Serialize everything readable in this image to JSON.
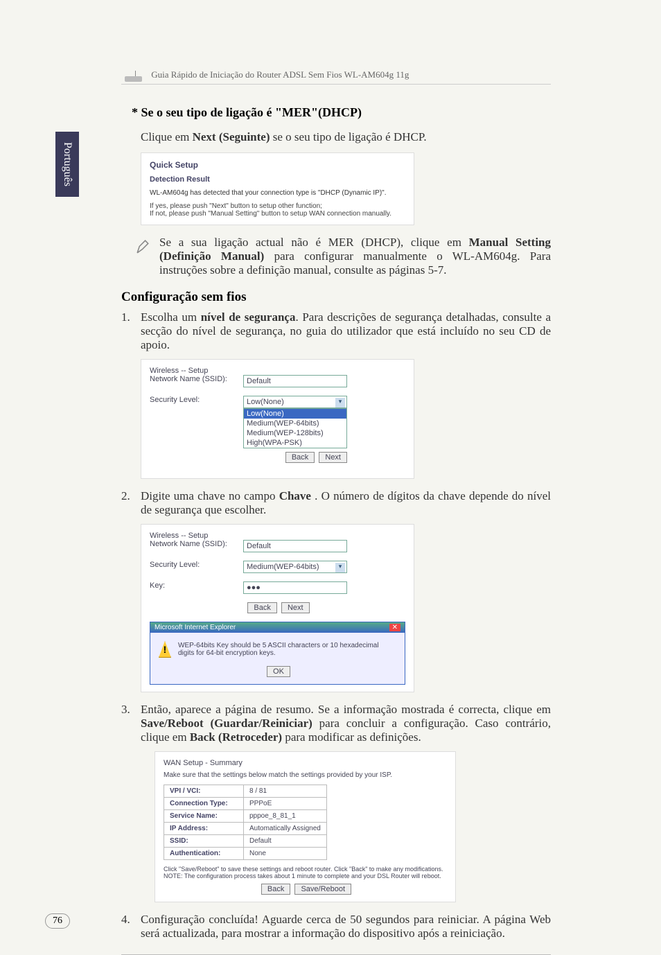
{
  "language_tab": "Português",
  "page_number": "76",
  "header": "Guia Rápido de Iniciação do Router ADSL Sem Fios WL-AM604g 11g",
  "star_heading": "* Se o seu tipo de ligação é \"MER\"(DHCP)",
  "click_next": "Clique em ",
  "click_next_bold": "Next (Seguinte)",
  "click_next_suffix": " se o seu tipo de ligação é DHCP.",
  "quicksetup": {
    "title": "Quick Setup",
    "subtitle": "Detection Result",
    "detected": "WL-AM604g has detected that your connection type is \"DHCP (Dynamic IP)\".",
    "hint1": "If yes, please push \"Next\" button to setup other function;",
    "hint2": "If not, please push \"Manual Setting\" button to setup WAN connection manually."
  },
  "note": {
    "l1_a": "Se a sua ligação actual não é MER (DHCP), clique em ",
    "l1_b": "Manual Setting (Definição Manual)",
    "l1_c": " para configurar manualmente o WL-AM604g. Para instruções sobre a definição manual, consulte as páginas 5-7."
  },
  "section_header": "Configuração sem fios",
  "step1": {
    "a": "Escolha um ",
    "b": "nível de segurança",
    "c": ". Para descrições de segurança detalhadas, consulte a secção do nível de segurança, no guia do utilizador que está incluído no seu CD de apoio."
  },
  "wireless1": {
    "title": "Wireless -- Setup",
    "ssid_label": "Network Name (SSID):",
    "ssid_value": "Default",
    "sec_label": "Security Level:",
    "sec_value": "Low(None)",
    "opts": [
      "Low(None)",
      "Medium(WEP-64bits)",
      "Medium(WEP-128bits)",
      "High(WPA-PSK)"
    ],
    "back": "Back",
    "next": "Next"
  },
  "step2": {
    "a": "Digite uma chave no campo ",
    "b": "Chave",
    "c": " . O número de dígitos da chave depende do nível de segurança que escolher."
  },
  "wireless2": {
    "title": "Wireless -- Setup",
    "ssid_label": "Network Name (SSID):",
    "ssid_value": "Default",
    "sec_label": "Security Level:",
    "sec_value": "Medium(WEP-64bits)",
    "key_label": "Key:",
    "key_value": "●●●",
    "back": "Back",
    "next": "Next",
    "dialog_title": "Microsoft Internet Explorer",
    "dialog_msg": "WEP-64bits Key should be 5 ASCII characters or 10 hexadecimal digits for 64-bit encryption keys.",
    "dialog_ok": "OK"
  },
  "step3": {
    "a": "Então, aparece a página de resumo. Se a informação mostrada é correcta, clique em ",
    "b": "Save/Reboot (Guardar/Reiniciar)",
    "c": " para concluir a configuração. Caso contrário, clique em ",
    "d": "Back (Retroceder)",
    "e": " para modificar as definições."
  },
  "summary": {
    "title": "WAN Setup - Summary",
    "intro": "Make sure that the settings below match the settings provided by your ISP.",
    "rows": [
      [
        "VPI / VCI:",
        "8 / 81"
      ],
      [
        "Connection Type:",
        "PPPoE"
      ],
      [
        "Service Name:",
        "pppoe_8_81_1"
      ],
      [
        "IP Address:",
        "Automatically Assigned"
      ],
      [
        "SSID:",
        "Default"
      ],
      [
        "Authentication:",
        "None"
      ]
    ],
    "note": "Click \"Save/Reboot\" to save these settings and reboot router. Click \"Back\" to make any modifications. NOTE: The configuration process takes about 1 minute to complete and your DSL Router will reboot.",
    "back": "Back",
    "savereboot": "Save/Reboot"
  },
  "step4": "Configuração concluída! Aguarde cerca de 50 segundos para reiniciar. A página Web será actualizada, para mostrar a informação do dispositivo após a reiniciação."
}
